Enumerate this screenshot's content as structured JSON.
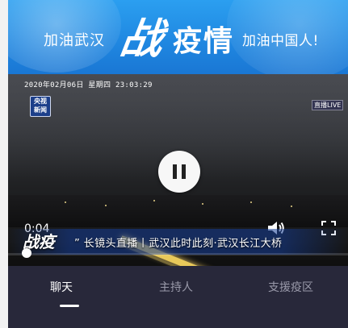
{
  "banner": {
    "left_slogan": "加油武汉",
    "big_char": "战",
    "big_rest": "疫情",
    "right_slogan": "加油中国人!"
  },
  "video": {
    "datetime": "2020年02月06日  星期四  23:03:29",
    "channel_logo_line1": "央视",
    "channel_logo_line2": "新闻",
    "live_badge": "直播LIVE",
    "elapsed": "0:04",
    "ticker_mark": "战疫",
    "ticker_text": "” 长镜头直播丨武汉此时此刻·武汉长江大桥",
    "progress": 0.01
  },
  "tabs": {
    "chat": "聊天",
    "host": "主持人",
    "zone": "支援疫区"
  }
}
